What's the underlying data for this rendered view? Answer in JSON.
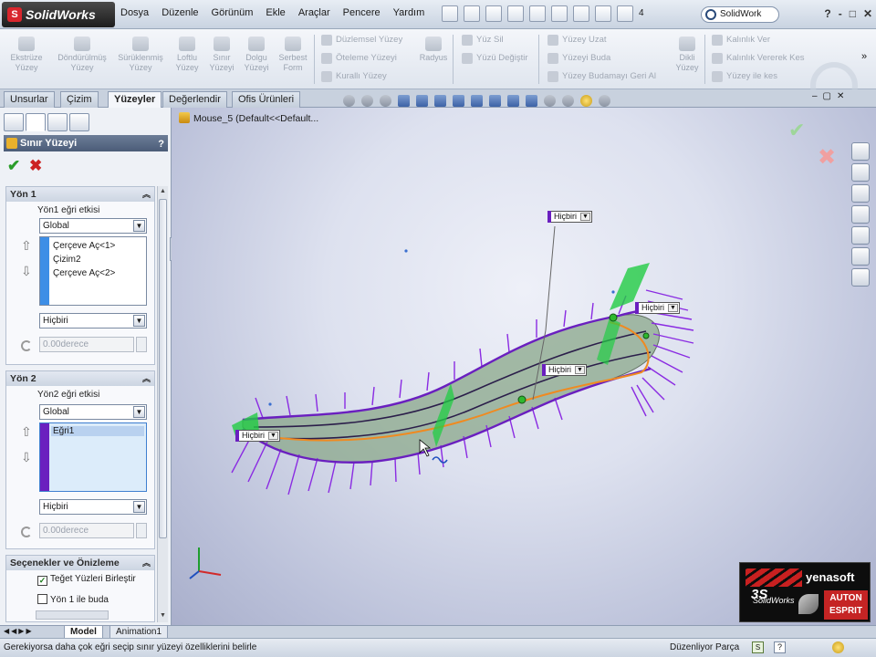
{
  "app": {
    "logo_text": "SolidWorks",
    "logo_mark": "S"
  },
  "menu": [
    "Dosya",
    "Düzenle",
    "Görünüm",
    "Ekle",
    "Araçlar",
    "Pencere",
    "Yardım"
  ],
  "search": {
    "placeholder": "SolidWork"
  },
  "toolbar_counter": "4",
  "window_controls": [
    "?",
    "-",
    "□",
    "✕"
  ],
  "command_manager": {
    "big": [
      {
        "line1": "Ekstrüze",
        "line2": "Yüzey"
      },
      {
        "line1": "Döndürülmüş",
        "line2": "Yüzey"
      },
      {
        "line1": "Sürüklenmiş",
        "line2": "Yüzey"
      },
      {
        "line1": "Loftlu",
        "line2": "Yüzey"
      },
      {
        "line1": "Sınır",
        "line2": "Yüzeyi"
      },
      {
        "line1": "Dolgu",
        "line2": "Yüzeyi"
      },
      {
        "line1": "Serbest",
        "line2": "Form"
      }
    ],
    "small": [
      "Düzlemsel Yüzey",
      "Öteleme Yüzeyi",
      "Kurallı Yüzey",
      "Radyus",
      "Yüz Sil",
      "Yüzü Değiştir",
      "Yüzey Uzat",
      "Yüzeyi Buda",
      "Yüzey Budamayı Geri Al",
      "Dikli",
      "Yüzey",
      "Kalınlık Ver",
      "Kalınlık Vererek Kes",
      "Yüzey ile kes"
    ]
  },
  "tabs": [
    {
      "label": "Unsurlar",
      "active": false
    },
    {
      "label": "Çizim",
      "active": false
    },
    {
      "label": "Yüzeyler",
      "active": true
    },
    {
      "label": "Değerlendir",
      "active": false
    },
    {
      "label": "Ofis Ürünleri",
      "active": false
    }
  ],
  "property_manager": {
    "title": "Sınır Yüzeyi",
    "help": "?",
    "ok": "✔",
    "cancel": "✖",
    "direction1": {
      "heading": "Yön 1",
      "influence_label": "Yön1 eğri etkisi",
      "influence_value": "Global",
      "items": [
        "Çerçeve Aç<1>",
        "Çizim2",
        "Çerçeve Aç<2>"
      ],
      "tangency_value": "Hiçbiri",
      "angle_value": "0.00derece"
    },
    "direction2": {
      "heading": "Yön 2",
      "influence_label": "Yön2 eğri etkisi",
      "influence_value": "Global",
      "items": [
        "Eğri1"
      ],
      "tangency_value": "Hiçbiri",
      "angle_value": "0.00derece"
    },
    "options": {
      "heading": "Seçenekler ve Önizleme",
      "merge_tangent": {
        "label": "Teğet Yüzleri Birleştir",
        "checked": true
      },
      "trim_by_dir1": {
        "label": "Yön 1 ile buda",
        "checked": false
      }
    }
  },
  "viewport": {
    "tree_path": "Mouse_5  (Default<<Default...",
    "callouts": [
      "Hiçbiri",
      "Hiçbiri",
      "Hiçbiri",
      "Hiçbiri"
    ]
  },
  "brand": {
    "name": "yenasoft",
    "ds": "3S",
    "sw": "SolidWorks",
    "badge_line1": "AUTON",
    "badge_line2": "ESPRIT"
  },
  "bottom_tabs": [
    {
      "label": "Model",
      "active": true
    },
    {
      "label": "Animation1",
      "active": false
    }
  ],
  "status": {
    "message": "Gerekiyorsa daha çok eğri seçip sınır yüzeyi özelliklerini belirle",
    "state": "Düzenliyor Parça"
  },
  "colors": {
    "accent_purple": "#6a1fbf",
    "accent_blue": "#3d8ee6",
    "surface": "#8aa78a",
    "curve_orange": "#f08a20",
    "ok_green": "#2a9d2a",
    "cancel_red": "#cc2222"
  }
}
